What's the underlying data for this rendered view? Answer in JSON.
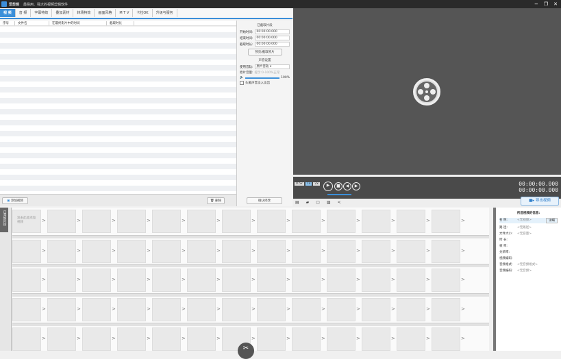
{
  "titlebar": {
    "app": "爱剪辑",
    "subtitle": "最易用、强大的视频剪辑软件",
    "min": "−",
    "max": "❐",
    "close": "✕"
  },
  "tabs": [
    "视 频",
    "音 频",
    "字幕特效",
    "叠加素材",
    "转场特效",
    "画面风格",
    "M T V",
    "卡拉OK",
    "升级与服务"
  ],
  "list": {
    "columns": [
      "序号",
      "文件名",
      "在最终影片中的时间",
      "截取时长"
    ],
    "add_button": "添加视频",
    "delete_button": "删除"
  },
  "side": {
    "clip_section": "已截取片段",
    "start_label": "开始时间:",
    "start": "00:00:00.000",
    "end_label": "结束时间:",
    "end": "00:00:00.000",
    "dur_label": "截取时长:",
    "dur": "00:00:00.000",
    "pick_button": "预览/截取原片",
    "sound_section": "声音设置",
    "track_label": "使用音轨:",
    "track_value": "原片音轨",
    "volume_label": "原片音量:",
    "volume_hint": "提示:0-100%正常",
    "volume_pct": "100%",
    "volume_level": 100,
    "fade_label": "头尾声音淡入淡出",
    "confirm_button": "确认修改"
  },
  "player": {
    "time_current": "00:00:00.000",
    "time_total": "00:00:00.000",
    "speed": [
      "0.5x",
      "1x",
      "2x"
    ],
    "export_button": "导出视频"
  },
  "timeline": {
    "vtab": "已添加片段",
    "placeholder": "双击此处添加视频",
    "rows": 5,
    "cols": 13
  },
  "info": {
    "title": "所选视频的信息:",
    "fields": [
      [
        "名 称:",
        "<无视频>"
      ],
      [
        "路 径:",
        "<无路径>"
      ],
      [
        "文件大小:",
        "<无容量>"
      ],
      [
        "时 长:",
        ""
      ],
      [
        "帧 率:",
        ""
      ],
      [
        "分辨率:",
        ""
      ],
      [
        "视频编码:",
        ""
      ],
      [
        "音频格式:",
        "<无音频格式>"
      ],
      [
        "音频编码:",
        "<无音频>"
      ]
    ],
    "open_button": "详细"
  }
}
